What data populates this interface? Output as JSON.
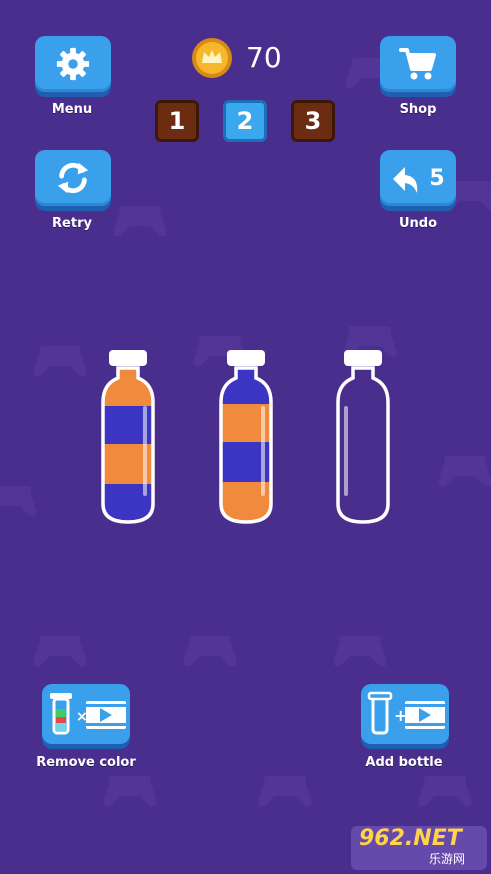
{
  "top_left": {
    "menu_label": "Menu",
    "retry_label": "Retry"
  },
  "top_right": {
    "shop_label": "Shop",
    "undo_label": "Undo",
    "undo_count": "5"
  },
  "coins": {
    "amount": "70"
  },
  "levels": [
    {
      "number": "1",
      "active": false
    },
    {
      "number": "2",
      "active": true
    },
    {
      "number": "3",
      "active": false
    }
  ],
  "colors": {
    "background": "#4a2e8e",
    "button_blue": "#3aa0ec",
    "liquid_orange": "#f08a3c",
    "liquid_blue": "#3c35c4",
    "level_brown": "#6b2c12"
  },
  "bottles": [
    {
      "layers_top_to_bottom": [
        "orange",
        "blue",
        "orange",
        "blue"
      ]
    },
    {
      "layers_top_to_bottom": [
        "blue",
        "orange",
        "blue",
        "orange"
      ]
    },
    {
      "layers_top_to_bottom": []
    }
  ],
  "bottom": {
    "remove_color_label": "Remove color",
    "add_bottle_label": "Add bottle"
  },
  "watermark": {
    "text": "962.NET",
    "subtext": "乐游网"
  }
}
